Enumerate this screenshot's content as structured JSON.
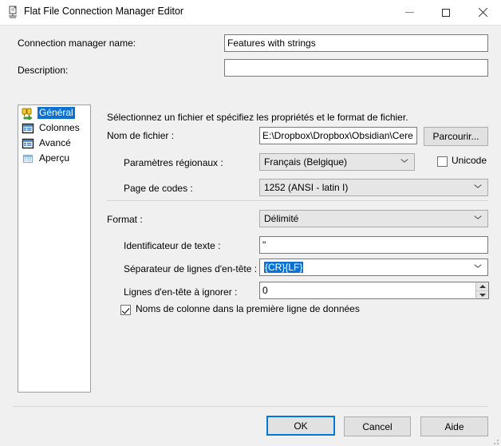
{
  "window": {
    "title": "Flat File Connection Manager Editor",
    "icon": "flat-file-connection-icon",
    "minimize": "minimize-icon",
    "maximize": "maximize-icon",
    "close": "close-icon"
  },
  "header": {
    "connection_name_label": "Connection manager name:",
    "connection_name_value": "Features with strings",
    "description_label": "Description:",
    "description_value": ""
  },
  "nav": {
    "items": [
      {
        "label": "Général",
        "icon": "connection-icon",
        "selected": true
      },
      {
        "label": "Colonnes",
        "icon": "table-icon",
        "selected": false
      },
      {
        "label": "Avancé",
        "icon": "table-icon",
        "selected": false
      },
      {
        "label": "Aperçu",
        "icon": "table-preview-icon",
        "selected": false
      }
    ]
  },
  "general": {
    "instruction": "Sélectionnez un fichier et spécifiez les propriétés et le format de fichier.",
    "file_name_label": "Nom de fichier :",
    "file_name_value": "E:\\Dropbox\\Dropbox\\Obsidian\\Cere",
    "browse_button": "Parcourir...",
    "locale_label": "Paramètres régionaux :",
    "locale_value": "Français (Belgique)",
    "unicode_label": "Unicode",
    "unicode_checked": false,
    "codepage_label": "Page de codes :",
    "codepage_value": "1252  (ANSI - latin I)",
    "format_label": "Format :",
    "format_value": "Délimité",
    "text_qualifier_label": "Identificateur de texte :",
    "text_qualifier_value": "\"",
    "header_row_delimiter_label": "Séparateur de lignes d'en-tête :",
    "header_row_delimiter_value": "{CR}{LF}",
    "header_rows_skip_label": "Lignes d'en-tête à ignorer :",
    "header_rows_skip_value": "0",
    "column_names_label": "Noms de colonne dans la première ligne de données",
    "column_names_checked": true
  },
  "footer": {
    "ok": "OK",
    "cancel": "Cancel",
    "help": "Aide"
  },
  "colors": {
    "accent": "#0078d7",
    "selection": "#0b72d4",
    "dialog_bg": "#f0f0f0",
    "titlebar_bg": "#ffffff"
  }
}
